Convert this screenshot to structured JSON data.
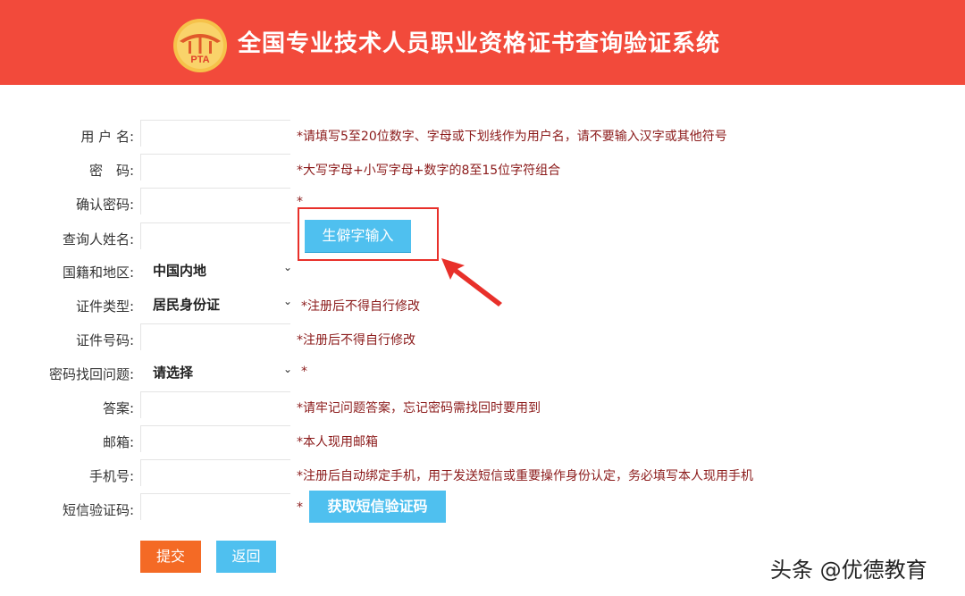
{
  "header": {
    "title": "全国专业技术人员职业资格证书查询验证系统",
    "logo_text": "PTA",
    "bg_color": "#f24a3b"
  },
  "form": {
    "username": {
      "label": "用 户 名:",
      "hint": "*请填写5至20位数字、字母或下划线作为用户名，请不要输入汉字或其他符号"
    },
    "password": {
      "label": "密　码:",
      "hint": "*大写字母+小写字母+数字的8至15位字符组合"
    },
    "confirm_password": {
      "label": "确认密码:",
      "hint": "*"
    },
    "query_name": {
      "label": "查询人姓名:",
      "rare_char_button": "生僻字输入"
    },
    "nationality": {
      "label": "国籍和地区:",
      "selected": "中国内地"
    },
    "id_type": {
      "label": "证件类型:",
      "selected": "居民身份证",
      "hint": "*注册后不得自行修改"
    },
    "id_number": {
      "label": "证件号码:",
      "hint": "*注册后不得自行修改"
    },
    "security_question": {
      "label": "密码找回问题:",
      "selected": "请选择",
      "hint": "*"
    },
    "answer": {
      "label": "答案:",
      "hint": "*请牢记问题答案，忘记密码需找回时要用到"
    },
    "email": {
      "label": "邮箱:",
      "hint": "*本人现用邮箱"
    },
    "phone": {
      "label": "手机号:",
      "hint": "*注册后自动绑定手机，用于发送短信或重要操作身份认定，务必填写本人现用手机"
    },
    "sms_code": {
      "label": "短信验证码:",
      "hint": "*",
      "get_code_button": "获取短信验证码"
    }
  },
  "actions": {
    "submit": "提交",
    "back": "返回"
  },
  "watermark": "头条 @优德教育",
  "colors": {
    "accent_blue": "#4fc0ef",
    "submit_orange": "#f46a25",
    "hint_red": "#8b1a1a",
    "highlight_red": "#e8302a"
  }
}
